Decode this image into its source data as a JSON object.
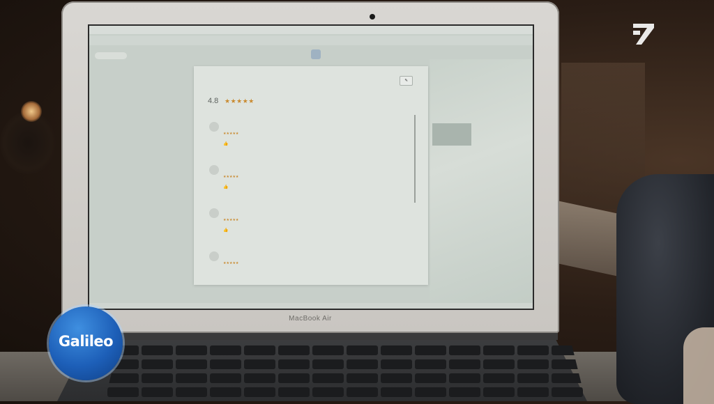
{
  "laptop": {
    "brand": "MacBook Air"
  },
  "browser": {
    "menubar_text": "",
    "tab_left": "",
    "tab_right": "",
    "status_text": ""
  },
  "reviews_panel": {
    "write_review_label": "",
    "rating_score": "4.8",
    "rating_stars": "★★★★★",
    "review_count": "",
    "sort_label": "",
    "reviews": [
      {
        "stars": "★★★★★",
        "text": "",
        "thumb": "👍"
      },
      {
        "stars": "★★★★★",
        "text": "",
        "thumb": "👍"
      },
      {
        "stars": "★★★★★",
        "text": "",
        "thumb": "👍"
      },
      {
        "stars": "★★★★★",
        "text": "",
        "thumb": ""
      }
    ]
  },
  "overlay": {
    "show_logo": "Galileo",
    "channel": "ProSieben"
  },
  "colors": {
    "star": "#c98a2f",
    "galileo_blue": "#1d5fb8"
  }
}
